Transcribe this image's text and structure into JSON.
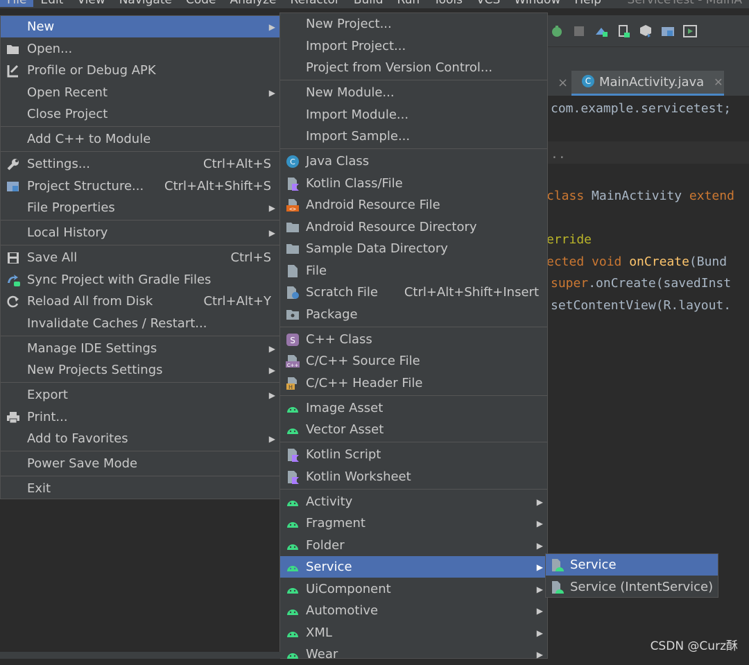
{
  "menubar": {
    "items": [
      "File",
      "Edit",
      "View",
      "Navigate",
      "Code",
      "Analyze",
      "Refactor",
      "Build",
      "Run",
      "Tools",
      "VCS",
      "Window",
      "Help"
    ],
    "title": "ServiceTest - MainA"
  },
  "editor_tab": {
    "label": "MainActivity.java"
  },
  "code": {
    "line1": "com.example.servicetest;",
    "line2": "..",
    "line3a": "class ",
    "line3b": "MainActivity ",
    "line3c": "extend",
    "line4": "erride",
    "line5a": "ected void ",
    "line5b": "onCreate",
    "line5c": "(Bund",
    "line6a": "super",
    "line6b": ".onCreate(savedInst",
    "line7": "setContentView(R.layout."
  },
  "file_menu": {
    "new": "New",
    "open": "Open...",
    "profile_apk": "Profile or Debug APK",
    "open_recent": "Open Recent",
    "close_project": "Close Project",
    "add_cpp": "Add C++ to Module",
    "settings": "Settings...",
    "settings_sc": "Ctrl+Alt+S",
    "project_structure": "Project Structure...",
    "project_structure_sc": "Ctrl+Alt+Shift+S",
    "file_properties": "File Properties",
    "local_history": "Local History",
    "save_all": "Save All",
    "save_all_sc": "Ctrl+S",
    "sync_gradle": "Sync Project with Gradle Files",
    "reload": "Reload All from Disk",
    "reload_sc": "Ctrl+Alt+Y",
    "invalidate": "Invalidate Caches / Restart...",
    "manage_ide": "Manage IDE Settings",
    "new_projects_settings": "New Projects Settings",
    "export": "Export",
    "print": "Print...",
    "add_favorites": "Add to Favorites",
    "power_save": "Power Save Mode",
    "exit": "Exit"
  },
  "new_menu": {
    "new_project": "New Project...",
    "import_project": "Import Project...",
    "project_vcs": "Project from Version Control...",
    "new_module": "New Module...",
    "import_module": "Import Module...",
    "import_sample": "Import Sample...",
    "java_class": "Java Class",
    "kotlin_class": "Kotlin Class/File",
    "android_resource_file": "Android Resource File",
    "android_resource_dir": "Android Resource Directory",
    "sample_data_dir": "Sample Data Directory",
    "file": "File",
    "scratch_file": "Scratch File",
    "scratch_file_sc": "Ctrl+Alt+Shift+Insert",
    "package": "Package",
    "cpp_class": "C++ Class",
    "cpp_source": "C/C++ Source File",
    "cpp_header": "C/C++ Header File",
    "image_asset": "Image Asset",
    "vector_asset": "Vector Asset",
    "kotlin_script": "Kotlin Script",
    "kotlin_worksheet": "Kotlin Worksheet",
    "activity": "Activity",
    "fragment": "Fragment",
    "folder": "Folder",
    "service": "Service",
    "uicomponent": "UiComponent",
    "automotive": "Automotive",
    "xml": "XML",
    "wear": "Wear"
  },
  "service_menu": {
    "service": "Service",
    "intent_service": "Service (IntentService)"
  },
  "watermark": "CSDN @Curz酥",
  "colors": {
    "menu_bg": "#3c3f41",
    "selection": "#4b6eaf",
    "android_green": "#3ddc84",
    "editor_bg": "#2b2b2b"
  }
}
